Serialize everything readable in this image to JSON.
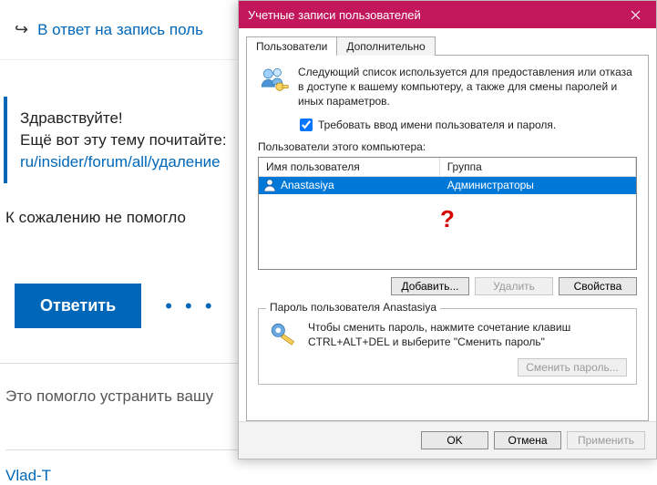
{
  "forum": {
    "reply_link": "В ответ на запись поль",
    "greeting": "Здравствуйте!",
    "readmore": "Ещё вот эту тему почитайте:",
    "thread_link": "ru/insider/forum/all/удаление",
    "regret": "К сожалению не помогло",
    "reply_btn": "Ответить",
    "dots": "• • •",
    "helpful": "Это помогло устранить вашу",
    "username": "Vlad-T"
  },
  "dialog": {
    "title": "Учетные записи пользователей",
    "tabs": {
      "a": "Пользователи",
      "b": "Дополнительно"
    },
    "intro": "Следующий список используется для предоставления или отказа в доступе к вашему компьютеру, а также для смены паролей и иных параметров.",
    "require_check": "Требовать ввод имени пользователя и пароля.",
    "users_label": "Пользователи этого компьютера:",
    "cols": {
      "name": "Имя пользователя",
      "group": "Группа"
    },
    "row": {
      "name": "Anastasiya",
      "group": "Администраторы"
    },
    "redq": "?",
    "buttons": {
      "add": "Добавить...",
      "remove": "Удалить",
      "props": "Свойства"
    },
    "group_legend": "Пароль пользователя Anastasiya",
    "group_text": "Чтобы сменить пароль, нажмите сочетание клавиш CTRL+ALT+DEL и выберите \"Сменить пароль\"",
    "change_pwd": "Сменить пароль...",
    "footer": {
      "ok": "OK",
      "cancel": "Отмена",
      "apply": "Применить"
    }
  }
}
